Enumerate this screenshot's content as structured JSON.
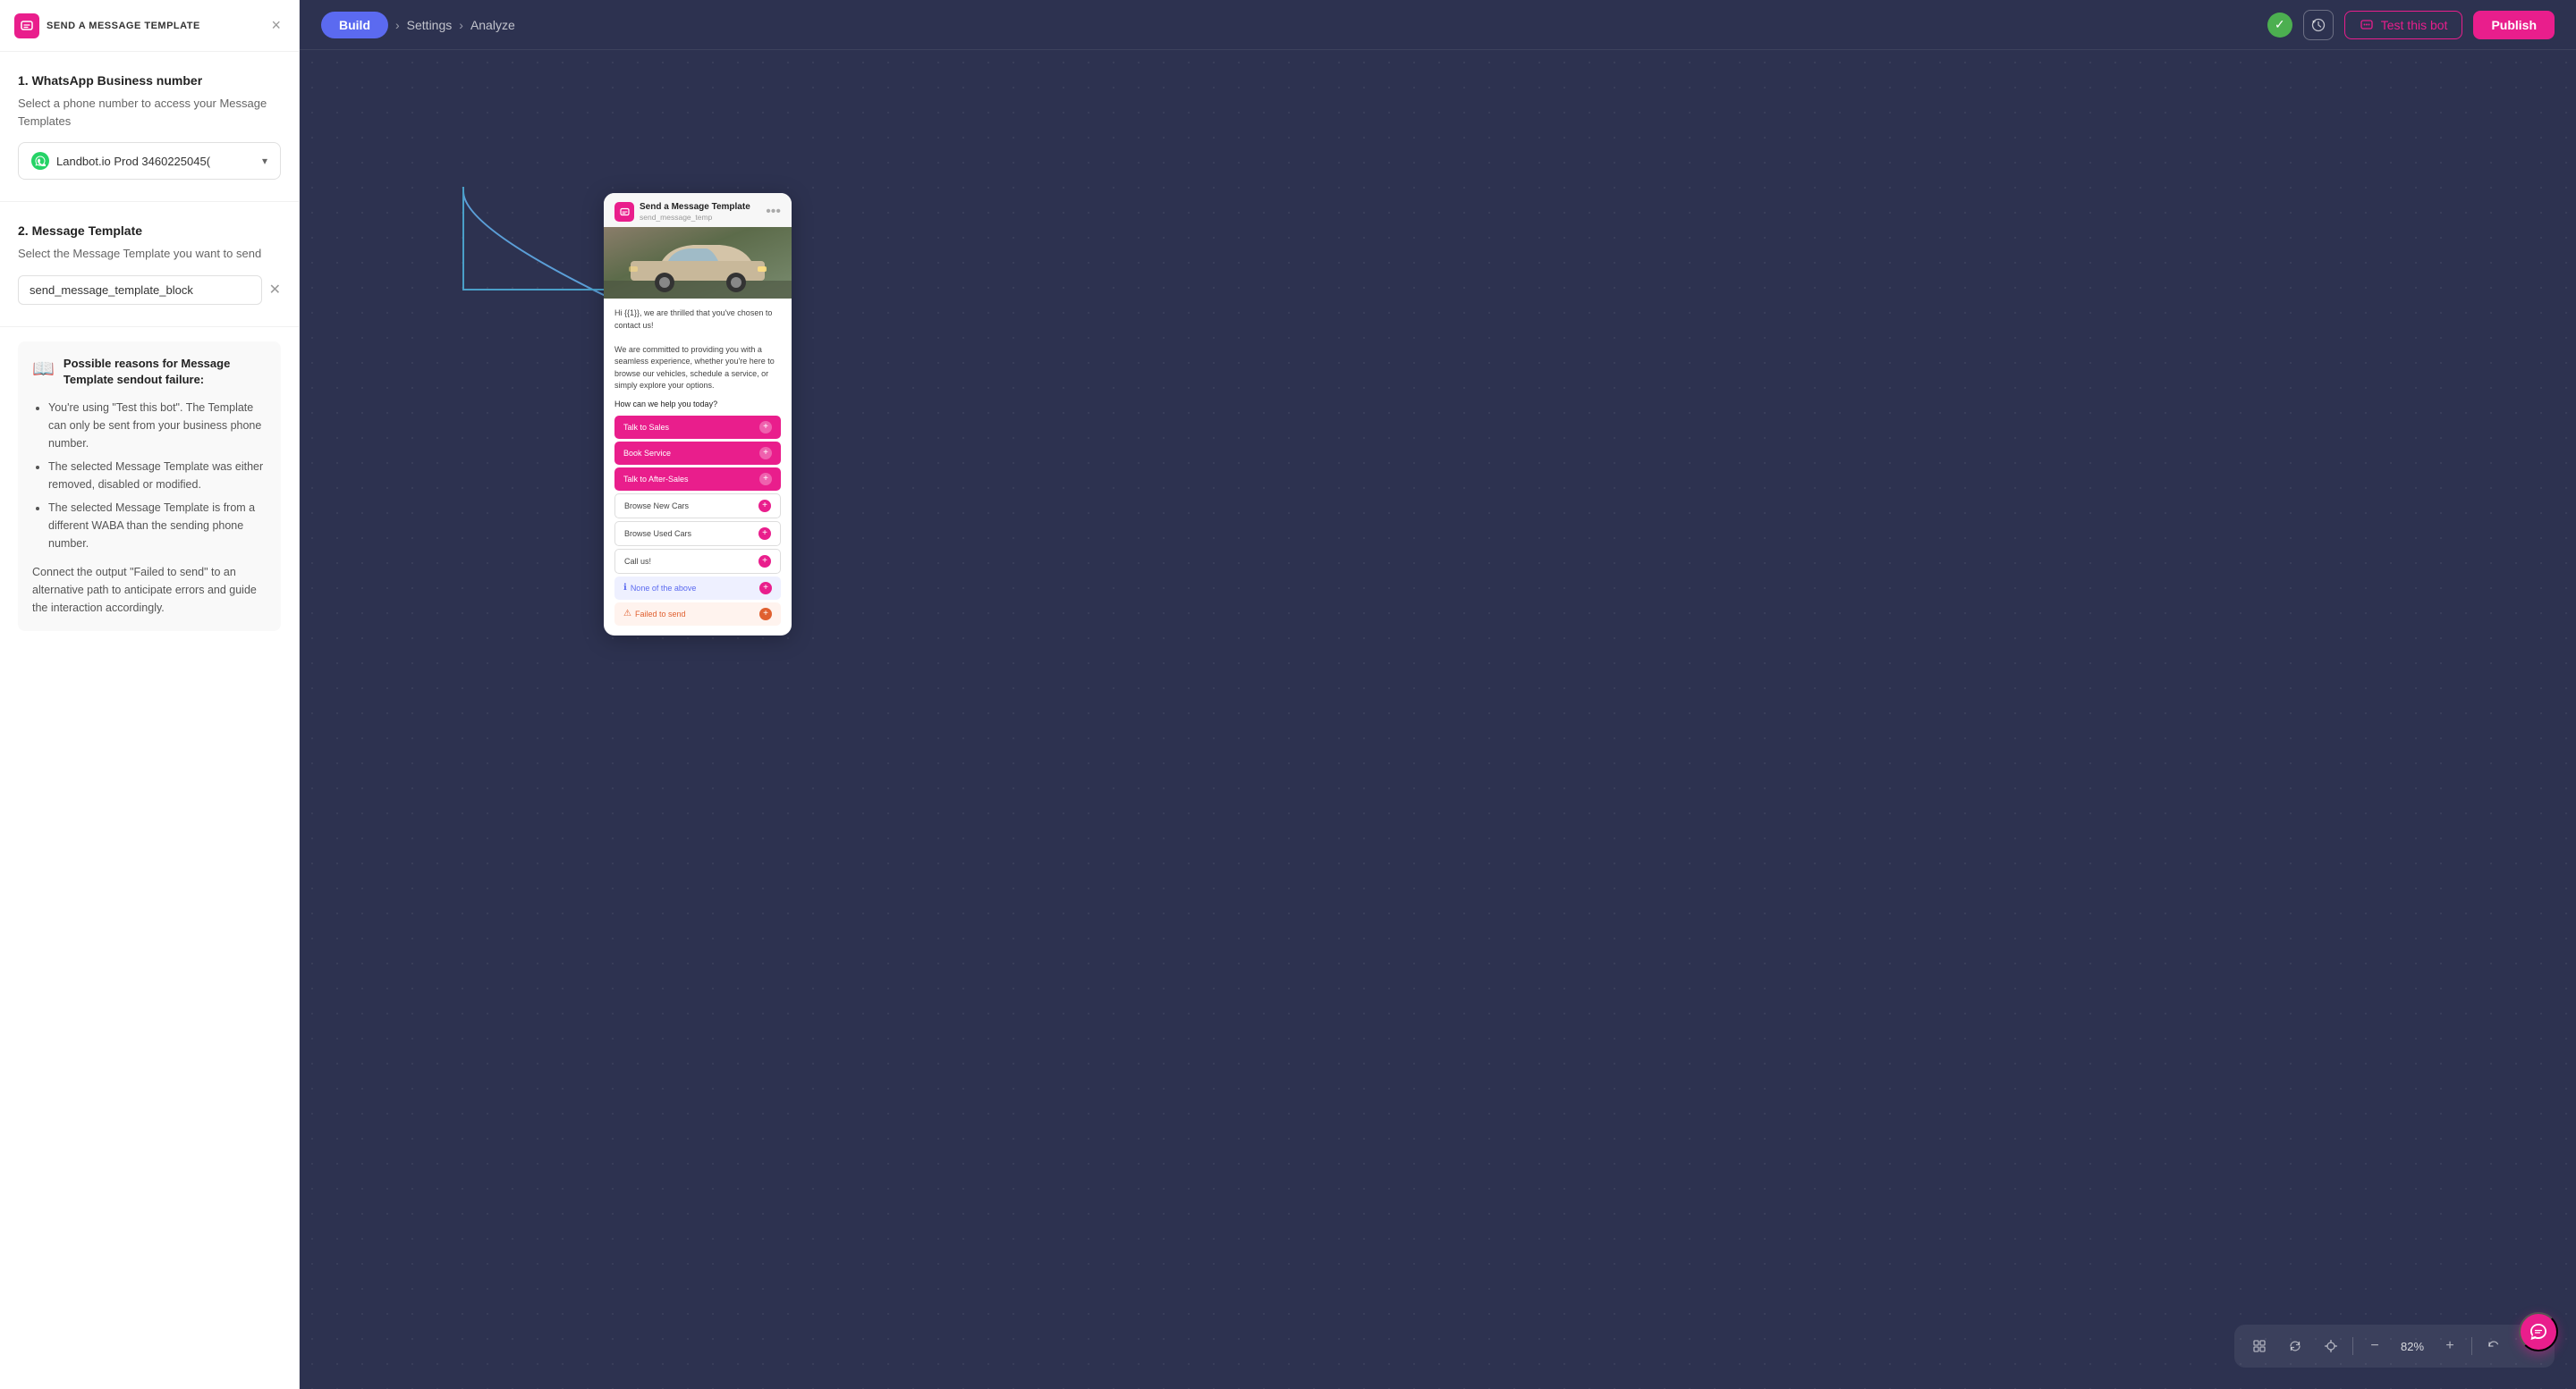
{
  "panel": {
    "header": {
      "title": "SEND A MESSAGE TEMPLATE",
      "close_label": "×"
    },
    "section1": {
      "title": "1. WhatsApp Business number",
      "description": "Select a phone number to access your Message Templates",
      "phone_value": "Landbot.io Prod 3460225045("
    },
    "section2": {
      "title": "2. Message Template",
      "description": "Select the Message Template you want to send",
      "template_value": "send_message_template_block"
    },
    "warning": {
      "title": "Possible reasons for Message Template sendout failure:",
      "reasons": [
        "You're using \"Test this bot\". The Template can only be sent from your business phone number.",
        "The selected Message Template was either removed, disabled or modified.",
        "The selected Message Template is from a different WABA than the sending phone number."
      ],
      "footer": "Connect the output \"Failed to send\" to an alternative path to anticipate errors and guide the interaction accordingly."
    }
  },
  "topnav": {
    "steps": [
      {
        "label": "Build",
        "active": true
      },
      {
        "label": "Settings",
        "active": false
      },
      {
        "label": "Analyze",
        "active": false
      }
    ],
    "test_btn": "Test this bot",
    "publish_btn": "Publish"
  },
  "card": {
    "title": "Send a Message Template",
    "subtitle": "send_message_temp",
    "message_text": "Hi {{1}}, we are thrilled that you've chosen to contact us!\n\nWe are committed to providing you with a seamless experience, whether you're here to browse our vehicles, schedule a service, or simply explore your options.",
    "question": "How can we help you today?",
    "buttons": [
      {
        "label": "Talk to Sales",
        "type": "pink"
      },
      {
        "label": "Book Service",
        "type": "pink"
      },
      {
        "label": "Talk to After-Sales",
        "type": "pink"
      },
      {
        "label": "Browse New Cars",
        "type": "outline"
      },
      {
        "label": "Browse Used Cars",
        "type": "outline"
      },
      {
        "label": "Call us!",
        "type": "outline"
      }
    ],
    "none_label": "None of the above",
    "failed_label": "Failed to send"
  },
  "toolbar": {
    "zoom": "82%",
    "zoom_label": "82%"
  }
}
